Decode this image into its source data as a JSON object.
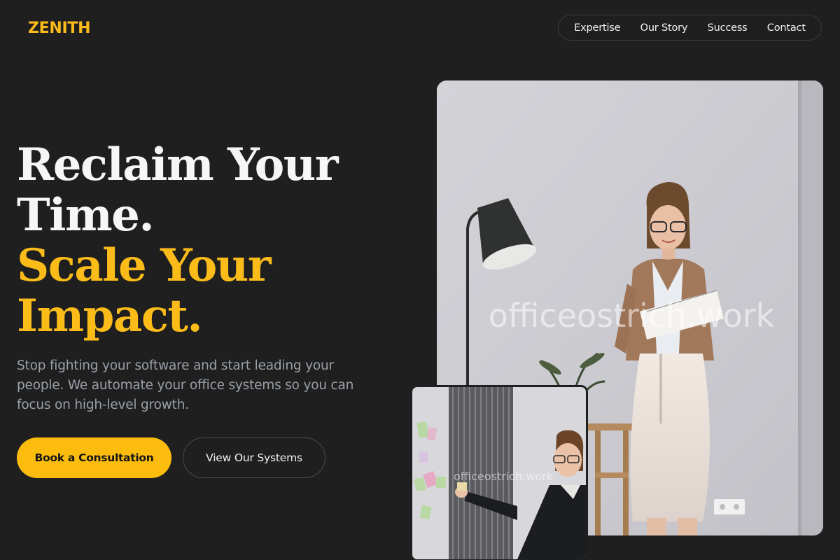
{
  "brand": {
    "logo": "ZENITH",
    "accent_color": "#fbbc1a"
  },
  "nav": {
    "items": [
      {
        "label": "Expertise"
      },
      {
        "label": "Our Story"
      },
      {
        "label": "Success"
      },
      {
        "label": "Contact"
      }
    ]
  },
  "hero": {
    "headline_line1": "Reclaim Your",
    "headline_line2": "Time.",
    "headline_line3": "Scale Your",
    "headline_line4": "Impact.",
    "description": "Stop fighting your software and start leading your people. We automate your office systems so you can focus on high-level growth.",
    "primary_cta": "Book a Consultation",
    "secondary_cta": "View Our Systems"
  },
  "images": {
    "main_watermark": "officeostrich.work",
    "small_watermark": "officeostrich.work"
  }
}
